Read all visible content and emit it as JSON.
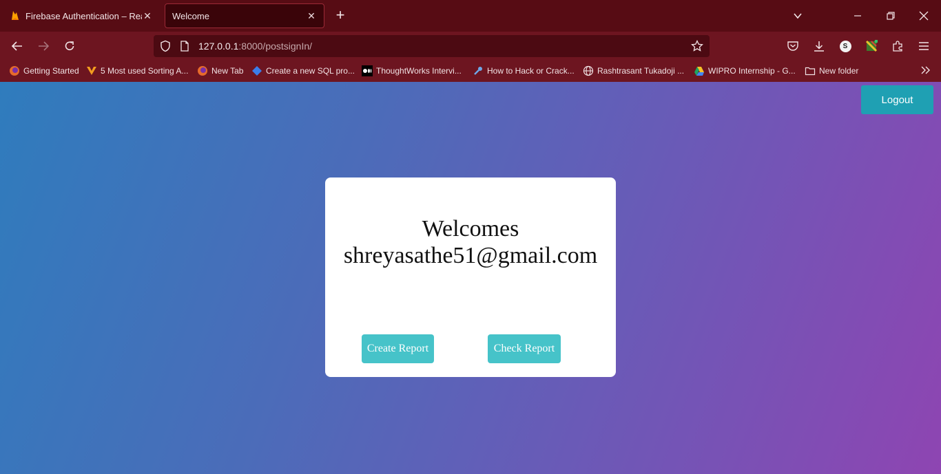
{
  "browser": {
    "tabs": [
      {
        "title": "Firebase Authentication – Realtim",
        "icon": "firebase-icon"
      },
      {
        "title": "Welcome",
        "icon": ""
      }
    ],
    "url_host": "127.0.0.1",
    "url_rest": ":8000/postsignIn/",
    "bookmarks": [
      {
        "label": "Getting Started",
        "icon": "firefox-icon"
      },
      {
        "label": "5 Most used Sorting A...",
        "icon": "sorting-icon"
      },
      {
        "label": "New Tab",
        "icon": "firefox-icon"
      },
      {
        "label": "Create a new SQL pro...",
        "icon": "sql-icon"
      },
      {
        "label": "ThoughtWorks Intervi...",
        "icon": "medium-icon"
      },
      {
        "label": "How to Hack or Crack...",
        "icon": "wrench-icon"
      },
      {
        "label": "Rashtrasant Tukadoji ...",
        "icon": "globe-icon"
      },
      {
        "label": "WIPRO Internship - G...",
        "icon": "drive-icon"
      },
      {
        "label": "New folder",
        "icon": "folder-icon"
      }
    ],
    "profile_initial": "S",
    "colors": {
      "tabbar": "#570c14",
      "toolbar": "#6d1520"
    }
  },
  "page": {
    "logout_label": "Logout",
    "welcome_line1": "Welcomes",
    "welcome_line2": "shreyasathe51@gmail.com",
    "create_report_label": "Create Report",
    "check_report_label": "Check Report",
    "colors": {
      "logout": "#1fa0b3",
      "card_button": "#46c3c9",
      "card": "#ffffff"
    }
  }
}
